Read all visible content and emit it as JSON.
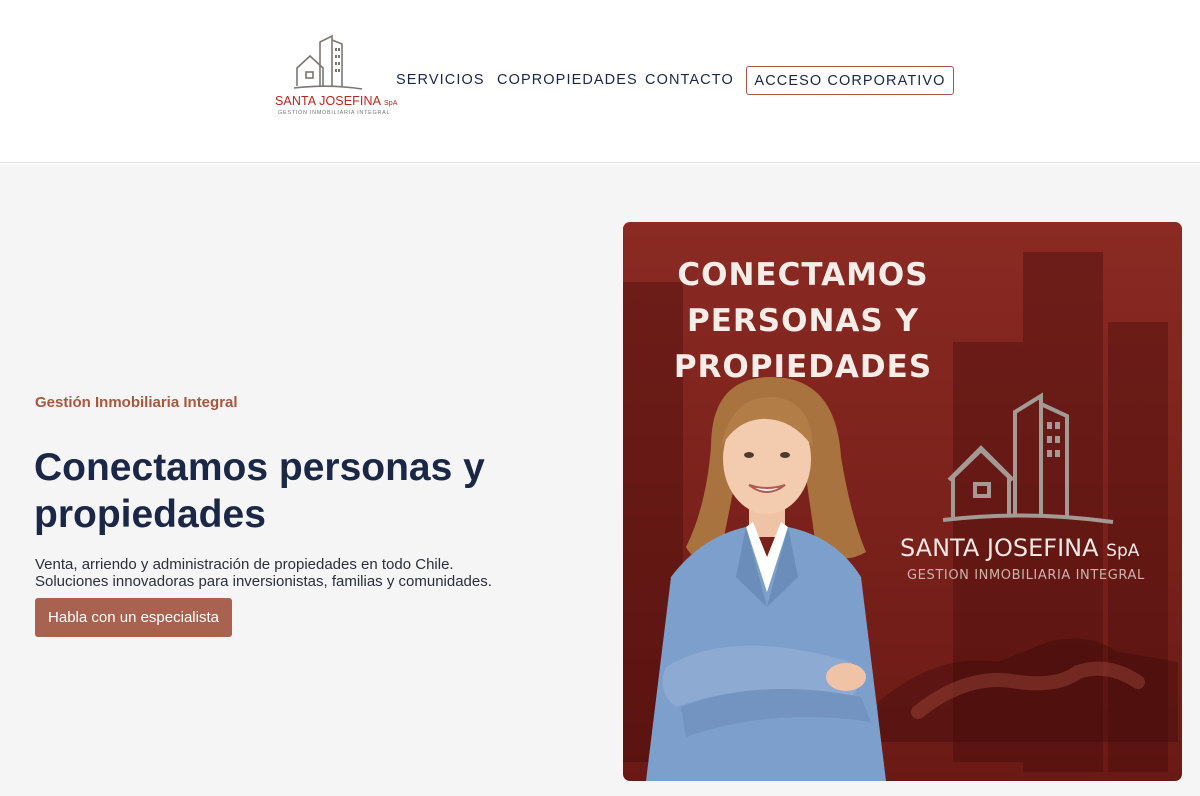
{
  "brand": {
    "name": "SANTA JOSEFINA",
    "suffix": "SpA",
    "tagline": "GESTIÓN INMOBILIARIA INTEGRAL",
    "logo_icon": "house-building-icon",
    "color": "#b5281f"
  },
  "nav": {
    "items": [
      {
        "label": "SERVICIOS"
      },
      {
        "label": "COPROPIEDADES"
      },
      {
        "label": "CONTACTO"
      }
    ],
    "cta_label": "ACCESO CORPORATIVO"
  },
  "hero": {
    "eyebrow": "Gestión Inmobiliaria Integral",
    "headline": "Conectamos personas y propiedades",
    "description_line1": "Venta, arriendo y administración de propiedades en todo Chile.",
    "description_line2": "Soluciones innovadoras para inversionistas, familias y comunidades.",
    "cta_label": "Habla con un especialista",
    "accent_color": "#a8624f"
  },
  "promo": {
    "title_line1": "CONECTAMOS",
    "title_line2": "PERSONAS Y",
    "title_line3": "PROPIEDADES",
    "brand_name": "SANTA JOSEFINA",
    "brand_suffix": "SpA",
    "brand_tagline": "GESTION INMOBILIARIA INTEGRAL",
    "background_color": "#7a211b"
  }
}
